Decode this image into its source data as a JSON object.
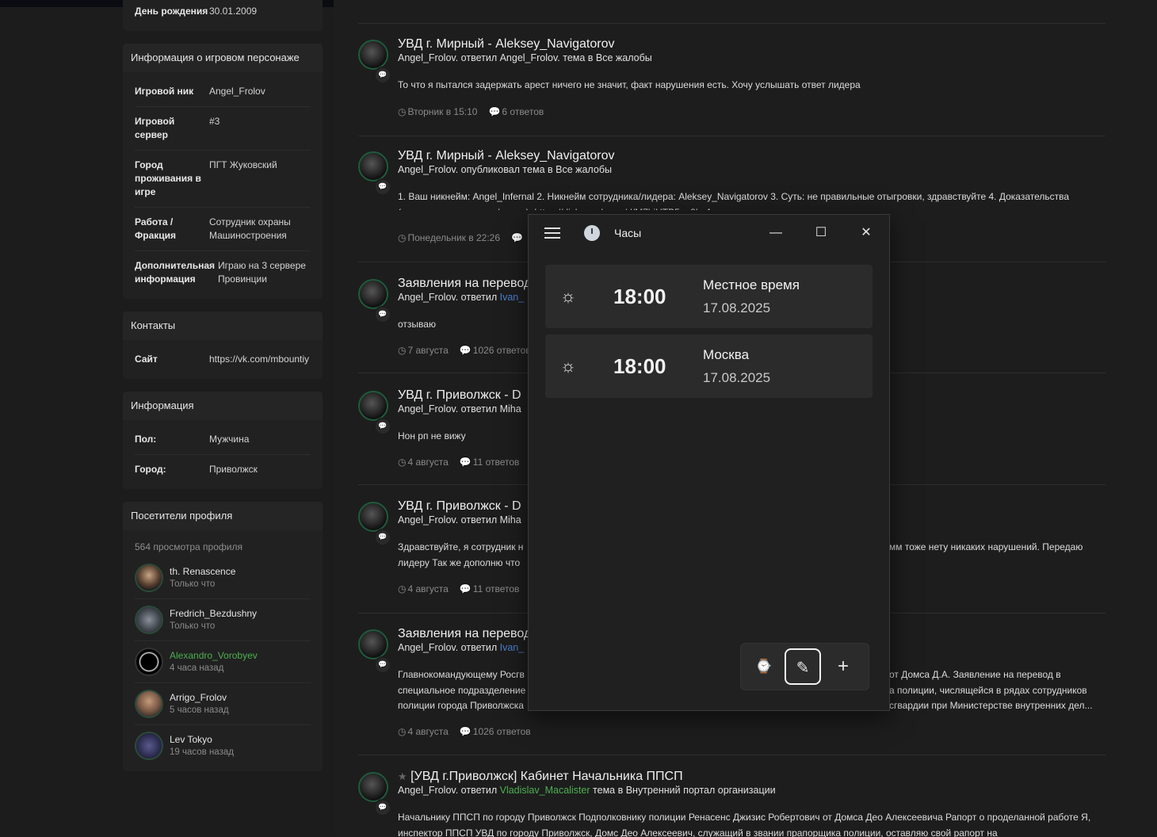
{
  "sidebar": {
    "birthday": {
      "key": "День рождения",
      "value": "30.01.2009"
    },
    "character": {
      "title": "Информация о игровом персонаже",
      "rows": [
        {
          "key": "Игровой ник",
          "value": "Angel_Frolov"
        },
        {
          "key": "Игровой сервер",
          "value": "#3"
        },
        {
          "key": "Город проживания в игре",
          "value": "ПГТ Жуковский"
        },
        {
          "key": "Работа / Фракция",
          "value": "Сотрудник охраны Машиностроения"
        },
        {
          "key": "Дополнительная информация",
          "value": "Играю на 3 сервере Провинции"
        }
      ]
    },
    "contacts": {
      "title": "Контакты",
      "rows": [
        {
          "key": "Сайт",
          "value": "https://vk.com/mbountiy"
        }
      ]
    },
    "info": {
      "title": "Информация",
      "rows": [
        {
          "key": "Пол:",
          "value": "Мужчина"
        },
        {
          "key": "Город:",
          "value": "Приволжск"
        }
      ]
    },
    "visitors": {
      "title": "Посетители профиля",
      "count": "564 просмотра профиля",
      "items": [
        {
          "name": "th. Renascence",
          "time": "Только что"
        },
        {
          "name": "Fredrich_Bezdushny",
          "time": "Только что"
        },
        {
          "name": "Alexandro_Vorobyev",
          "time": "4 часа назад"
        },
        {
          "name": "Arrigo_Frolov",
          "time": "5 часов назад"
        },
        {
          "name": "Lev Tokyo",
          "time": "19 часов назад"
        }
      ]
    }
  },
  "feed": {
    "items": [
      {
        "title": "УВД г. Мирный - Aleksey_Navigatorov",
        "meta": "Angel_Frolov. ответил Angel_Frolov. тема в Все жалобы",
        "text": "То что я пытался задержать арест ничего не значит, факт нарушения есть. Хочу услышать ответ лидера",
        "date": "Вторник в 15:10",
        "replies": "6 ответов"
      },
      {
        "title": "УВД г. Мирный - Aleksey_Navigatorov",
        "meta": "Angel_Frolov. опубликовал тема в Все жалобы",
        "text": "1. Ваш никнейм: Angel_Infernal 2. Никнейм сотрудника/лидера: Aleksey_Navigatorov 3. Суть: не правильные отыгровки, здравствуйте 4. Доказательства (ссылки на скриншоты/видео): https://disk.yandex.ru/d/M7biUTB5u_8k_A",
        "date": "Понедельник в 22:26",
        "replies": ""
      },
      {
        "title": "Заявления на перевод",
        "meta_prefix": "Angel_Frolov. ответил",
        "meta_link": "Ivan_",
        "text": "отзываю",
        "date": "7 августа",
        "replies": "1026 ответов"
      },
      {
        "title": "УВД г. Приволжск - D",
        "meta": "Angel_Frolov. ответил Miha",
        "text": "Нон рп не вижу",
        "date": "4 августа",
        "replies": "11 ответов"
      },
      {
        "title": "УВД г. Приволжск - D",
        "meta": "Angel_Frolov. ответил Miha",
        "text_left": "Здравствуйте, я сотрудник н",
        "text_right": "мм тоже нету никаких нарушений. Передаю",
        "text_line2": "лидеру Так же дополню что",
        "date": "4 августа",
        "replies": "11 ответов"
      },
      {
        "title": "Заявления на перевод",
        "meta_prefix": "Angel_Frolov. ответил",
        "meta_link": "Ivan_",
        "text_l1a": "Главнокомандующему Росгв",
        "text_l1b": "от Домса Д.А. Заявление на перевод в",
        "text_l2a": "специальное подразделение",
        "text_l2b": "а полиции, числящейся в рядах сотрудников",
        "text_l3a": "полиции города Приволжска",
        "text_l3b": "сгвардии при Министерстве внутренних дел...",
        "date": "4 августа",
        "replies": "1026 ответов"
      },
      {
        "title": "[УВД г.Приволжск] Кабинет Начальника ППСП",
        "meta_prefix": "Angel_Frolov. ответил",
        "meta_link": "Vladislav_Macalister",
        "meta_suffix": "тема в Внутренний портал организации",
        "text": "Начальнику ППСП по городу Приволжск Подполковнику полиции Ренасенс Джизис Робертович от Домса Део Алексеевича Рапорт о проделанной работе Я, инспектор ППСП УВД по городу Приволжск, Домс Део Алексеевич, служащий в звании прапорщика полиции, оставляю свой рапорт на"
      }
    ]
  },
  "clock_app": {
    "title": "Часы",
    "clocks": [
      {
        "time": "18:00",
        "name": "Местное время",
        "date": "17.08.2025"
      },
      {
        "time": "18:00",
        "name": "Москва",
        "date": "17.08.2025"
      }
    ]
  }
}
